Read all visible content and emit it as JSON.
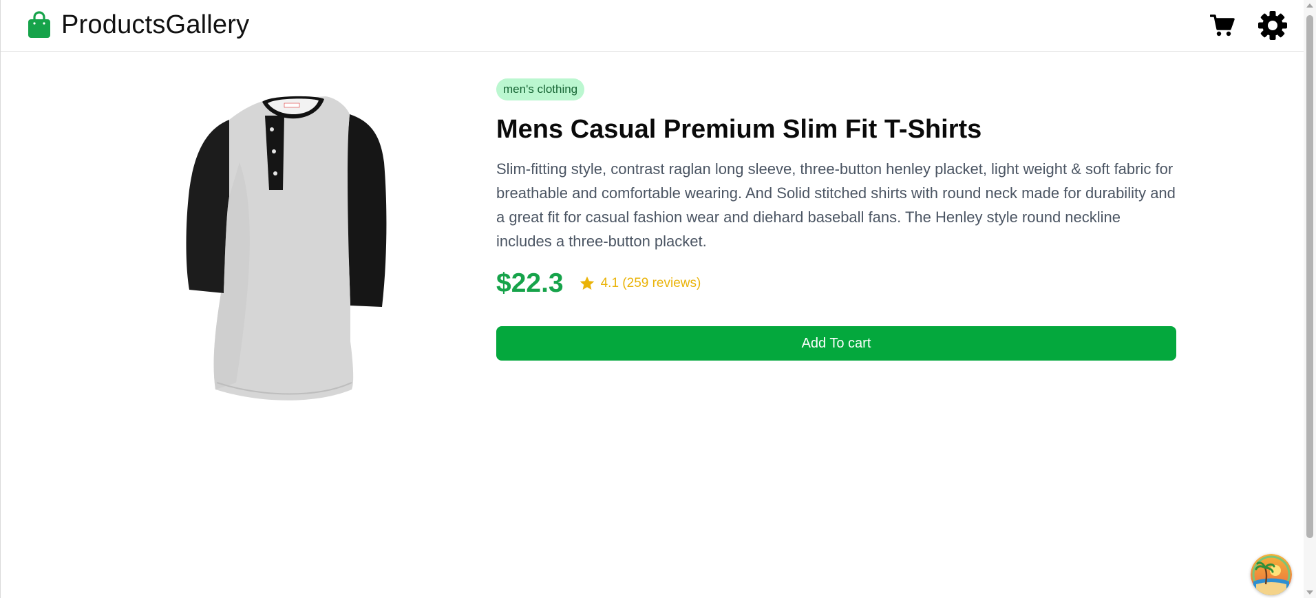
{
  "header": {
    "brand_name": "ProductsGallery",
    "brand_icon": "shopping-bag-icon",
    "actions": [
      {
        "name": "cart",
        "icon": "shopping-cart-icon"
      },
      {
        "name": "settings",
        "icon": "gear-icon"
      }
    ]
  },
  "product": {
    "category": "men's clothing",
    "title": "Mens Casual Premium Slim Fit T-Shirts",
    "description": "Slim-fitting style, contrast raglan long sleeve, three-button henley placket, light weight & soft fabric for breathable and comfortable wearing. And Solid stitched shirts with round neck made for durability and a great fit for casual fashion wear and diehard baseball fans. The Henley style round neckline includes a three-button placket.",
    "price": "$22.3",
    "rating_text": "4.1 (259 reviews)",
    "add_to_cart_label": "Add To cart"
  },
  "colors": {
    "brand_green": "#16a34a",
    "button_green": "#04a83d",
    "badge_bg": "#bbf7d0",
    "rating_yellow": "#eab308"
  }
}
